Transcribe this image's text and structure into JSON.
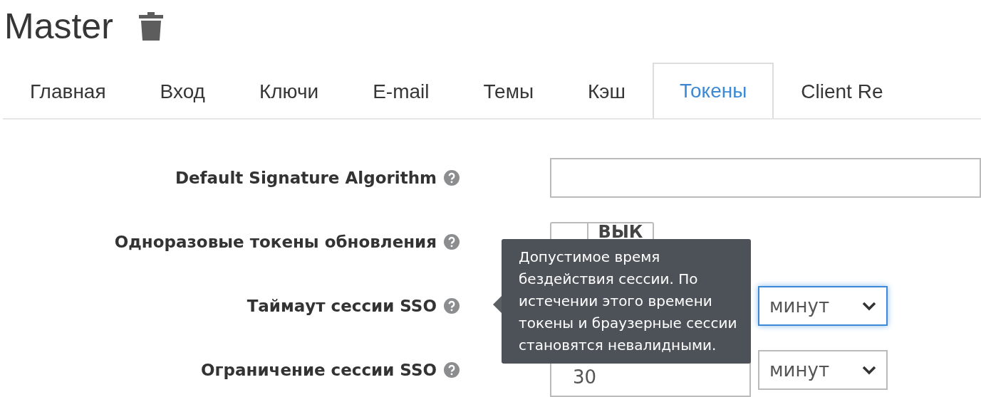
{
  "realm": {
    "title": "Master"
  },
  "tabs": [
    {
      "label": "Главная",
      "selected": false
    },
    {
      "label": "Вход",
      "selected": false
    },
    {
      "label": "Ключи",
      "selected": false
    },
    {
      "label": "E-mail",
      "selected": false
    },
    {
      "label": "Темы",
      "selected": false
    },
    {
      "label": "Кэш",
      "selected": false
    },
    {
      "label": "Токены",
      "selected": true
    },
    {
      "label": "Client Re",
      "selected": false
    }
  ],
  "fields": [
    {
      "kind": "text",
      "label": "Default Signature Algorithm"
    },
    {
      "kind": "toggle",
      "label": "Одноразовые токены обновления",
      "value": "ВЫК",
      "on": false
    },
    {
      "kind": "duration",
      "label": "Таймаут сессии SSO",
      "unit": "минут",
      "focused": true
    },
    {
      "kind": "duration",
      "label": "Ограничение сессии SSO",
      "value": "30",
      "unit": "минут",
      "focused": false
    }
  ],
  "tooltip": {
    "lines": [
      "Допустимое время",
      "бездействия сессии. По",
      "истечении этого времени",
      "токены и браузерные сессии",
      "становятся невалидными."
    ]
  }
}
